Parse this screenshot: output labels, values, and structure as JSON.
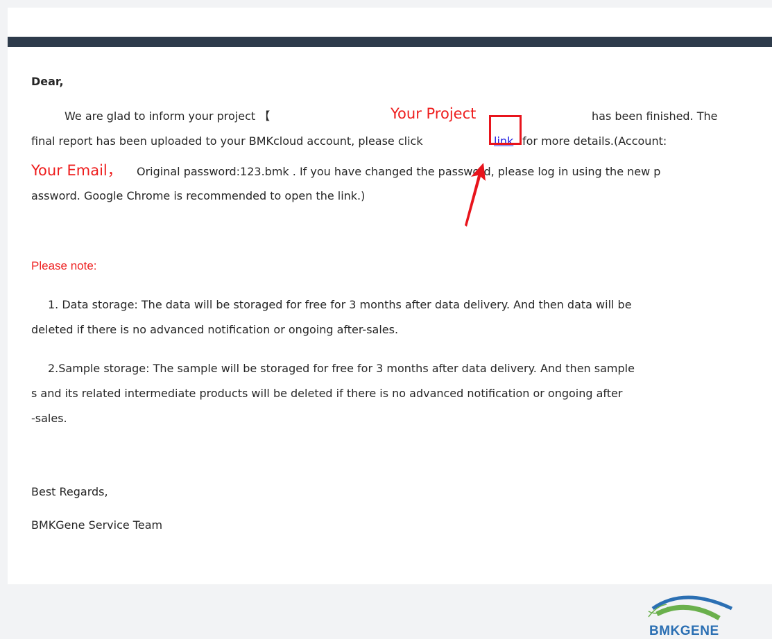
{
  "email": {
    "greeting": "Dear,",
    "para1": {
      "line1_start": "We are glad to inform your project 【",
      "annotation_project": "Your Project",
      "line1_end": "has been finished. The",
      "line2_start": "final report has been uploaded to your BMKcloud account, please click",
      "link_text": "link",
      "line2_end": "for more details.(Account:",
      "annotation_email": "Your Email，",
      "line3": "Original password:123.bmk . If you have changed the password, please log in using the new p",
      "line4": "assword. Google Chrome is recommended to open the link.)"
    },
    "note_heading": "Please note:",
    "note1": {
      "line1": "1. Data storage: The data will be storaged for free for 3 months after data delivery. And then data will be",
      "line2": "deleted if there is no advanced notification or ongoing after-sales."
    },
    "note2": {
      "line1": "2.Sample storage: The sample will be storaged for free for 3 months after data delivery. And then sample",
      "line2": "s and its     related intermediate products will be deleted if there is no advanced notification or ongoing after",
      "line3": "-sales."
    },
    "closing": "Best Regards,",
    "signature": "BMKGene Service Team"
  },
  "logo": {
    "text": "BMKGENE",
    "colors": {
      "arc_blue": "#2b6fb3",
      "arc_green": "#6ab04c"
    }
  },
  "colors": {
    "header_bar": "#2e3b4b",
    "annotation_red": "#ee1c1c",
    "link_blue": "#1a1ae0"
  }
}
